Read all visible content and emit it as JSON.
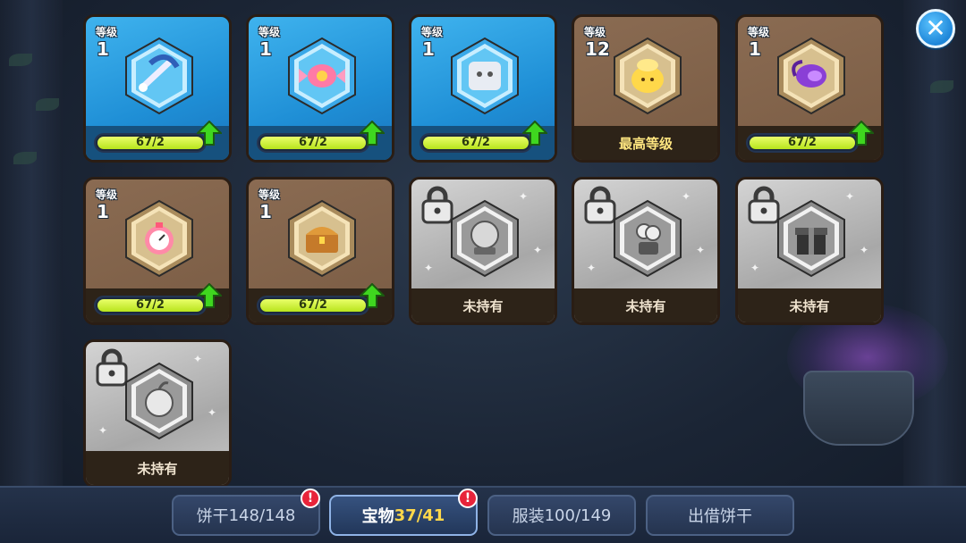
{
  "close_label": "✕",
  "level_label": "等级",
  "max_level_label": "最高等级",
  "not_owned_label": "未持有",
  "cards": [
    {
      "name": "treasure-card-blue-pickaxe",
      "style": "blue",
      "level": "1",
      "progress_text": "67/2",
      "progress": 1.0,
      "icon": "bone-pickaxe-icon",
      "state": "upgradable"
    },
    {
      "name": "treasure-card-candy",
      "style": "blue",
      "level": "1",
      "progress_text": "67/2",
      "progress": 1.0,
      "icon": "candy-icon",
      "state": "upgradable"
    },
    {
      "name": "treasure-card-scroll",
      "style": "blue",
      "level": "1",
      "progress_text": "67/2",
      "progress": 1.0,
      "icon": "ghost-scroll-icon",
      "state": "upgradable"
    },
    {
      "name": "treasure-card-gold-bun",
      "style": "brown",
      "level": "12",
      "progress_text": "",
      "progress": 1.0,
      "icon": "gold-bun-icon",
      "state": "max"
    },
    {
      "name": "treasure-card-purple-scroll",
      "style": "brown",
      "level": "1",
      "progress_text": "67/2",
      "progress": 1.0,
      "icon": "purple-scroll-icon",
      "state": "upgradable"
    },
    {
      "name": "treasure-card-stopwatch",
      "style": "brown",
      "level": "1",
      "progress_text": "67/2",
      "progress": 1.0,
      "icon": "stopwatch-icon",
      "state": "upgradable"
    },
    {
      "name": "treasure-card-chest",
      "style": "brown",
      "level": "1",
      "progress_text": "67/2",
      "progress": 1.0,
      "icon": "treasure-chest-icon",
      "state": "upgradable"
    },
    {
      "name": "treasure-card-snowglobe",
      "style": "locked",
      "icon": "snow-globe-icon",
      "state": "locked"
    },
    {
      "name": "treasure-card-flower",
      "style": "locked",
      "icon": "flower-pot-icon",
      "state": "locked"
    },
    {
      "name": "treasure-card-gift",
      "style": "locked",
      "icon": "gift-box-icon",
      "state": "locked"
    },
    {
      "name": "treasure-card-apple",
      "style": "locked",
      "icon": "apple-icon",
      "state": "locked"
    }
  ],
  "tabs": [
    {
      "name": "tab-cookies",
      "label": "饼干",
      "count": "148/148",
      "active": false,
      "badge": "!"
    },
    {
      "name": "tab-treasures",
      "label": "宝物",
      "count": "37/41",
      "active": true,
      "badge": "!"
    },
    {
      "name": "tab-costumes",
      "label": "服装",
      "count": "100/149",
      "active": false,
      "badge": ""
    },
    {
      "name": "tab-lend-cookies",
      "label": "出借饼干",
      "count": "",
      "active": false,
      "badge": ""
    }
  ],
  "colors": {
    "accent_blue": "#1f8fd6",
    "bar_fill": "#c6f02a",
    "upgrade_arrow": "#3fd61f",
    "badge_red": "#e8243a"
  }
}
